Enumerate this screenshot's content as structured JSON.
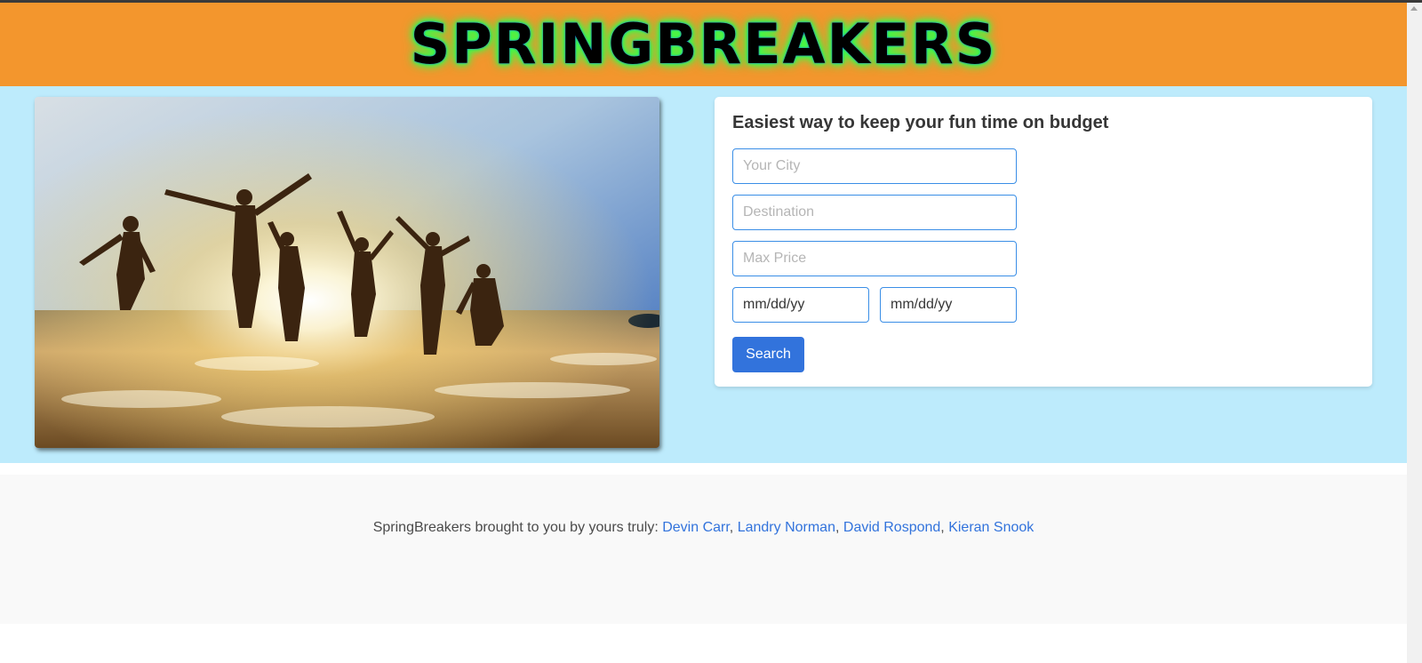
{
  "header": {
    "logo_text": "SPRINGBREAKERS"
  },
  "hero": {
    "image_alt": "Friends running into the sea at sunset",
    "form": {
      "title": "Easiest way to keep your fun time on budget",
      "city_placeholder": "Your City",
      "destination_placeholder": "Destination",
      "max_price_placeholder": "Max Price",
      "start_date_placeholder": "mm/dd/yy",
      "end_date_placeholder": "mm/dd/yy",
      "search_label": "Search"
    }
  },
  "footer": {
    "prefix": "SpringBreakers brought to you by yours truly:",
    "authors": [
      "Devin Carr",
      "Landry Norman",
      "David Rospond",
      "Kieran Snook"
    ],
    "separator": ","
  },
  "colors": {
    "header_bg": "#f3962d",
    "hero_bg": "#bdebfc",
    "logo_glow": "#39ff4a",
    "button_bg": "#3273dc",
    "link": "#3273dc",
    "input_border": "#3a8ee6"
  }
}
